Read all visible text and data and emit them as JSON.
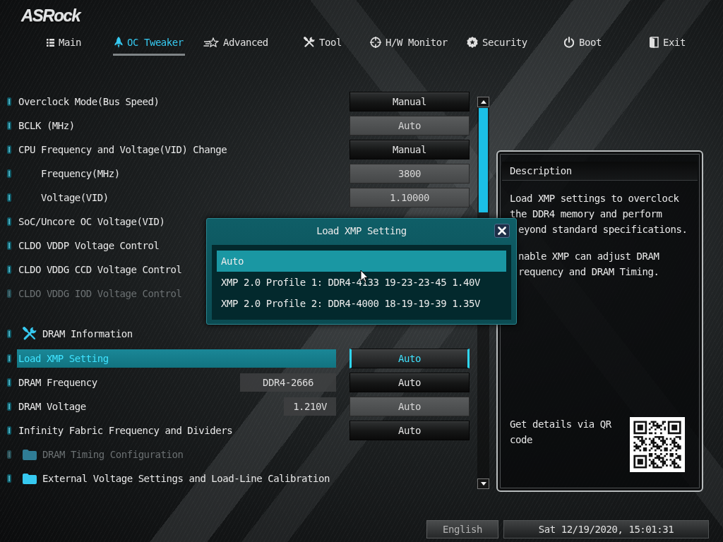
{
  "brand": "ASRock",
  "tabs": [
    {
      "label": "Main",
      "selected": false
    },
    {
      "label": "OC Tweaker",
      "selected": true
    },
    {
      "label": "Advanced",
      "selected": false
    },
    {
      "label": "Tool",
      "selected": false
    },
    {
      "label": "H/W Monitor",
      "selected": false
    },
    {
      "label": "Security",
      "selected": false
    },
    {
      "label": "Boot",
      "selected": false
    },
    {
      "label": "Exit",
      "selected": false
    }
  ],
  "settings": [
    {
      "kind": "setting",
      "label": "Overclock Mode(Bus Speed)",
      "selected": false,
      "disabled": false,
      "control": {
        "kind": "dropdown",
        "value": "Manual"
      }
    },
    {
      "kind": "setting",
      "label": "BCLK (MHz)",
      "selected": false,
      "disabled": false,
      "control": {
        "kind": "field",
        "value": "Auto"
      }
    },
    {
      "kind": "setting",
      "label": "CPU Frequency and Voltage(VID) Change",
      "selected": false,
      "disabled": false,
      "control": {
        "kind": "dropdown",
        "value": "Manual"
      },
      "children": [
        {
          "kind": "setting",
          "label": "Frequency(MHz)",
          "selected": false,
          "disabled": false,
          "control": {
            "kind": "field",
            "value": "3800"
          }
        },
        {
          "kind": "setting",
          "label": "Voltage(VID)",
          "selected": false,
          "disabled": false,
          "control": {
            "kind": "field",
            "value": "1.10000"
          }
        }
      ]
    },
    {
      "kind": "setting",
      "label": "SoC/Uncore OC Voltage(VID)",
      "selected": false,
      "disabled": false
    },
    {
      "kind": "setting",
      "label": "CLDO VDDP Voltage Control",
      "selected": false,
      "disabled": false
    },
    {
      "kind": "setting",
      "label": "CLDO VDDG CCD Voltage Control",
      "selected": false,
      "disabled": false
    },
    {
      "kind": "setting",
      "label": "CLDO VDDG IOD Voltage Control",
      "selected": false,
      "disabled": true
    },
    {
      "kind": "section",
      "label": "DRAM Information",
      "selected": false,
      "disabled": false
    },
    {
      "kind": "setting",
      "label": "Load XMP Setting",
      "selected": true,
      "disabled": false,
      "control": {
        "kind": "dropdown",
        "value": "Auto"
      }
    },
    {
      "kind": "setting",
      "label": "DRAM Frequency",
      "selected": false,
      "disabled": false,
      "reading": "DDR4-2666",
      "control": {
        "kind": "dropdown",
        "value": "Auto"
      }
    },
    {
      "kind": "setting",
      "label": "DRAM Voltage",
      "selected": false,
      "disabled": false,
      "reading": "1.210V",
      "control": {
        "kind": "field",
        "value": "Auto"
      }
    },
    {
      "kind": "setting",
      "label": "Infinity Fabric Frequency and Dividers",
      "selected": false,
      "disabled": false,
      "control": {
        "kind": "dropdown",
        "value": "Auto"
      }
    },
    {
      "kind": "folder",
      "label": "DRAM Timing Configuration",
      "selected": false,
      "disabled": true
    },
    {
      "kind": "folder",
      "label": "External Voltage Settings and Load-Line Calibration",
      "selected": false,
      "disabled": false
    }
  ],
  "popup": {
    "title": "Load XMP Setting",
    "options": [
      {
        "label": "Auto",
        "selected": true
      },
      {
        "label": "XMP 2.0 Profile 1: DDR4-4133 19-23-23-45 1.40V",
        "selected": false
      },
      {
        "label": "XMP 2.0 Profile 2: DDR4-4000 18-19-19-39 1.35V",
        "selected": false
      }
    ]
  },
  "description": {
    "title": "Description",
    "paragraphs": [
      {
        "lines": [
          {
            "text": "Load XMP settings to overclock",
            "covered": false
          },
          {
            "text": "the DDR4 memory and perform",
            "covered": false
          },
          {
            "text": "eyond standard specifications.",
            "covered": true
          }
        ]
      },
      {
        "lines": [
          {
            "text": "nable XMP can adjust DRAM",
            "covered": true
          },
          {
            "text": "requency and DRAM Timing.",
            "covered": true
          }
        ]
      }
    ],
    "qr_caption": "Get details via QR code"
  },
  "footer": {
    "language": "English",
    "datetime": "Sat 12/19/2020, 15:01:31"
  }
}
